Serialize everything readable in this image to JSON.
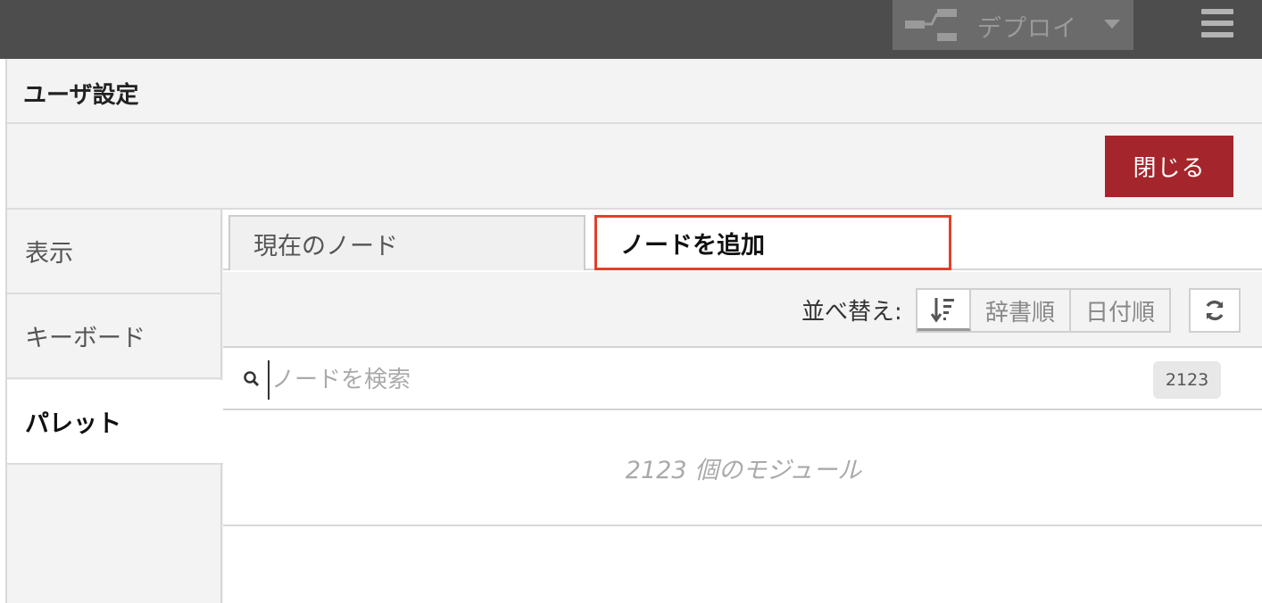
{
  "header": {
    "deploy_label": "デプロイ",
    "deploy_icon": "deploy-icon",
    "menu_icon": "hamburger-menu-icon"
  },
  "dialog": {
    "title": "ユーザ設定",
    "close_label": "閉じる",
    "accent_color": "#a4262c"
  },
  "sidenav": {
    "items": [
      {
        "label": "表示",
        "active": false
      },
      {
        "label": "キーボード",
        "active": false
      },
      {
        "label": "パレット",
        "active": true
      }
    ]
  },
  "palette": {
    "tabs": [
      {
        "label": "現在のノード",
        "active": false
      },
      {
        "label": "ノードを追加",
        "active": true
      }
    ],
    "sort": {
      "label": "並べ替え:",
      "options": [
        "辞書順",
        "日付順"
      ],
      "icon": "sort-descending-icon",
      "refresh_icon": "refresh-icon"
    },
    "search": {
      "placeholder": "ノードを検索",
      "value": "",
      "count": "2123"
    },
    "modules_text": "2123 個のモジュール"
  }
}
